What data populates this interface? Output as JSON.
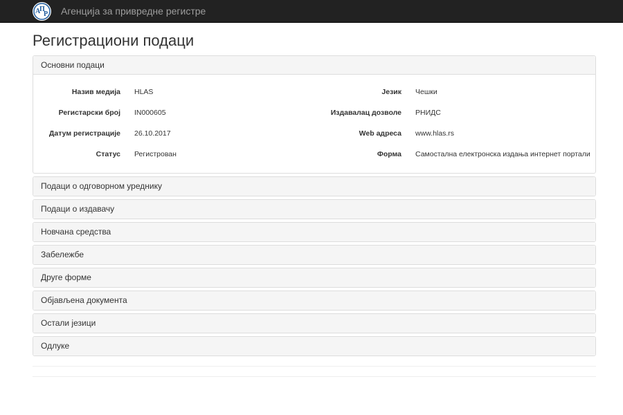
{
  "navbar": {
    "brand": "Агенција за привредне регистре",
    "logo_text": "АПР"
  },
  "page_title": "Регистрациони подаци",
  "basic_panel": {
    "title": "Основни подаци",
    "rows": [
      {
        "label1": "Назив медија",
        "value1": "HLAS",
        "label2": "Језик",
        "value2": "Чешки"
      },
      {
        "label1": "Регистарски број",
        "value1": "IN000605",
        "label2": "Издавалац дозволе",
        "value2": "РНИДС"
      },
      {
        "label1": "Датум регистрације",
        "value1": "26.10.2017",
        "label2": "Web адреса",
        "value2": "www.hlas.rs"
      },
      {
        "label1": "Статус",
        "value1": "Регистрован",
        "label2": "Форма",
        "value2": "Самостална електронска издања интернет портали"
      }
    ]
  },
  "collapsed_panels": [
    "Подаци о одговорном уреднику",
    "Подаци о издавачу",
    "Новчана средства",
    "Забележбе",
    "Друге форме",
    "Објављена документа",
    "Остали језици",
    "Одлуке"
  ],
  "colors": {
    "navbar": "#222222",
    "panel_heading": "#f5f5f5",
    "logo_blue": "#1d5a9c"
  }
}
